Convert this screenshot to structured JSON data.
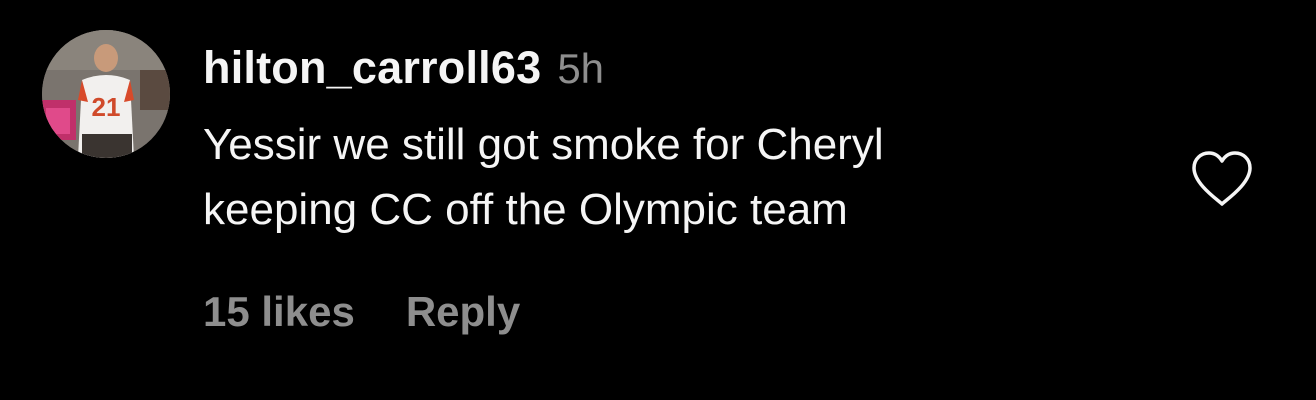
{
  "comment": {
    "username": "hilton_carroll63",
    "time": "5h",
    "text_lines": [
      "Yessir we still got smoke for Cheryl",
      "keeping CC off the Olympic team"
    ],
    "likes": "15 likes",
    "reply_label": "Reply",
    "like_icon": "heart-outline-icon",
    "avatar_jersey_number": "21"
  },
  "colors": {
    "background": "#000000",
    "primary_text": "#f5f5f5",
    "secondary_text": "#8e8e8e"
  }
}
